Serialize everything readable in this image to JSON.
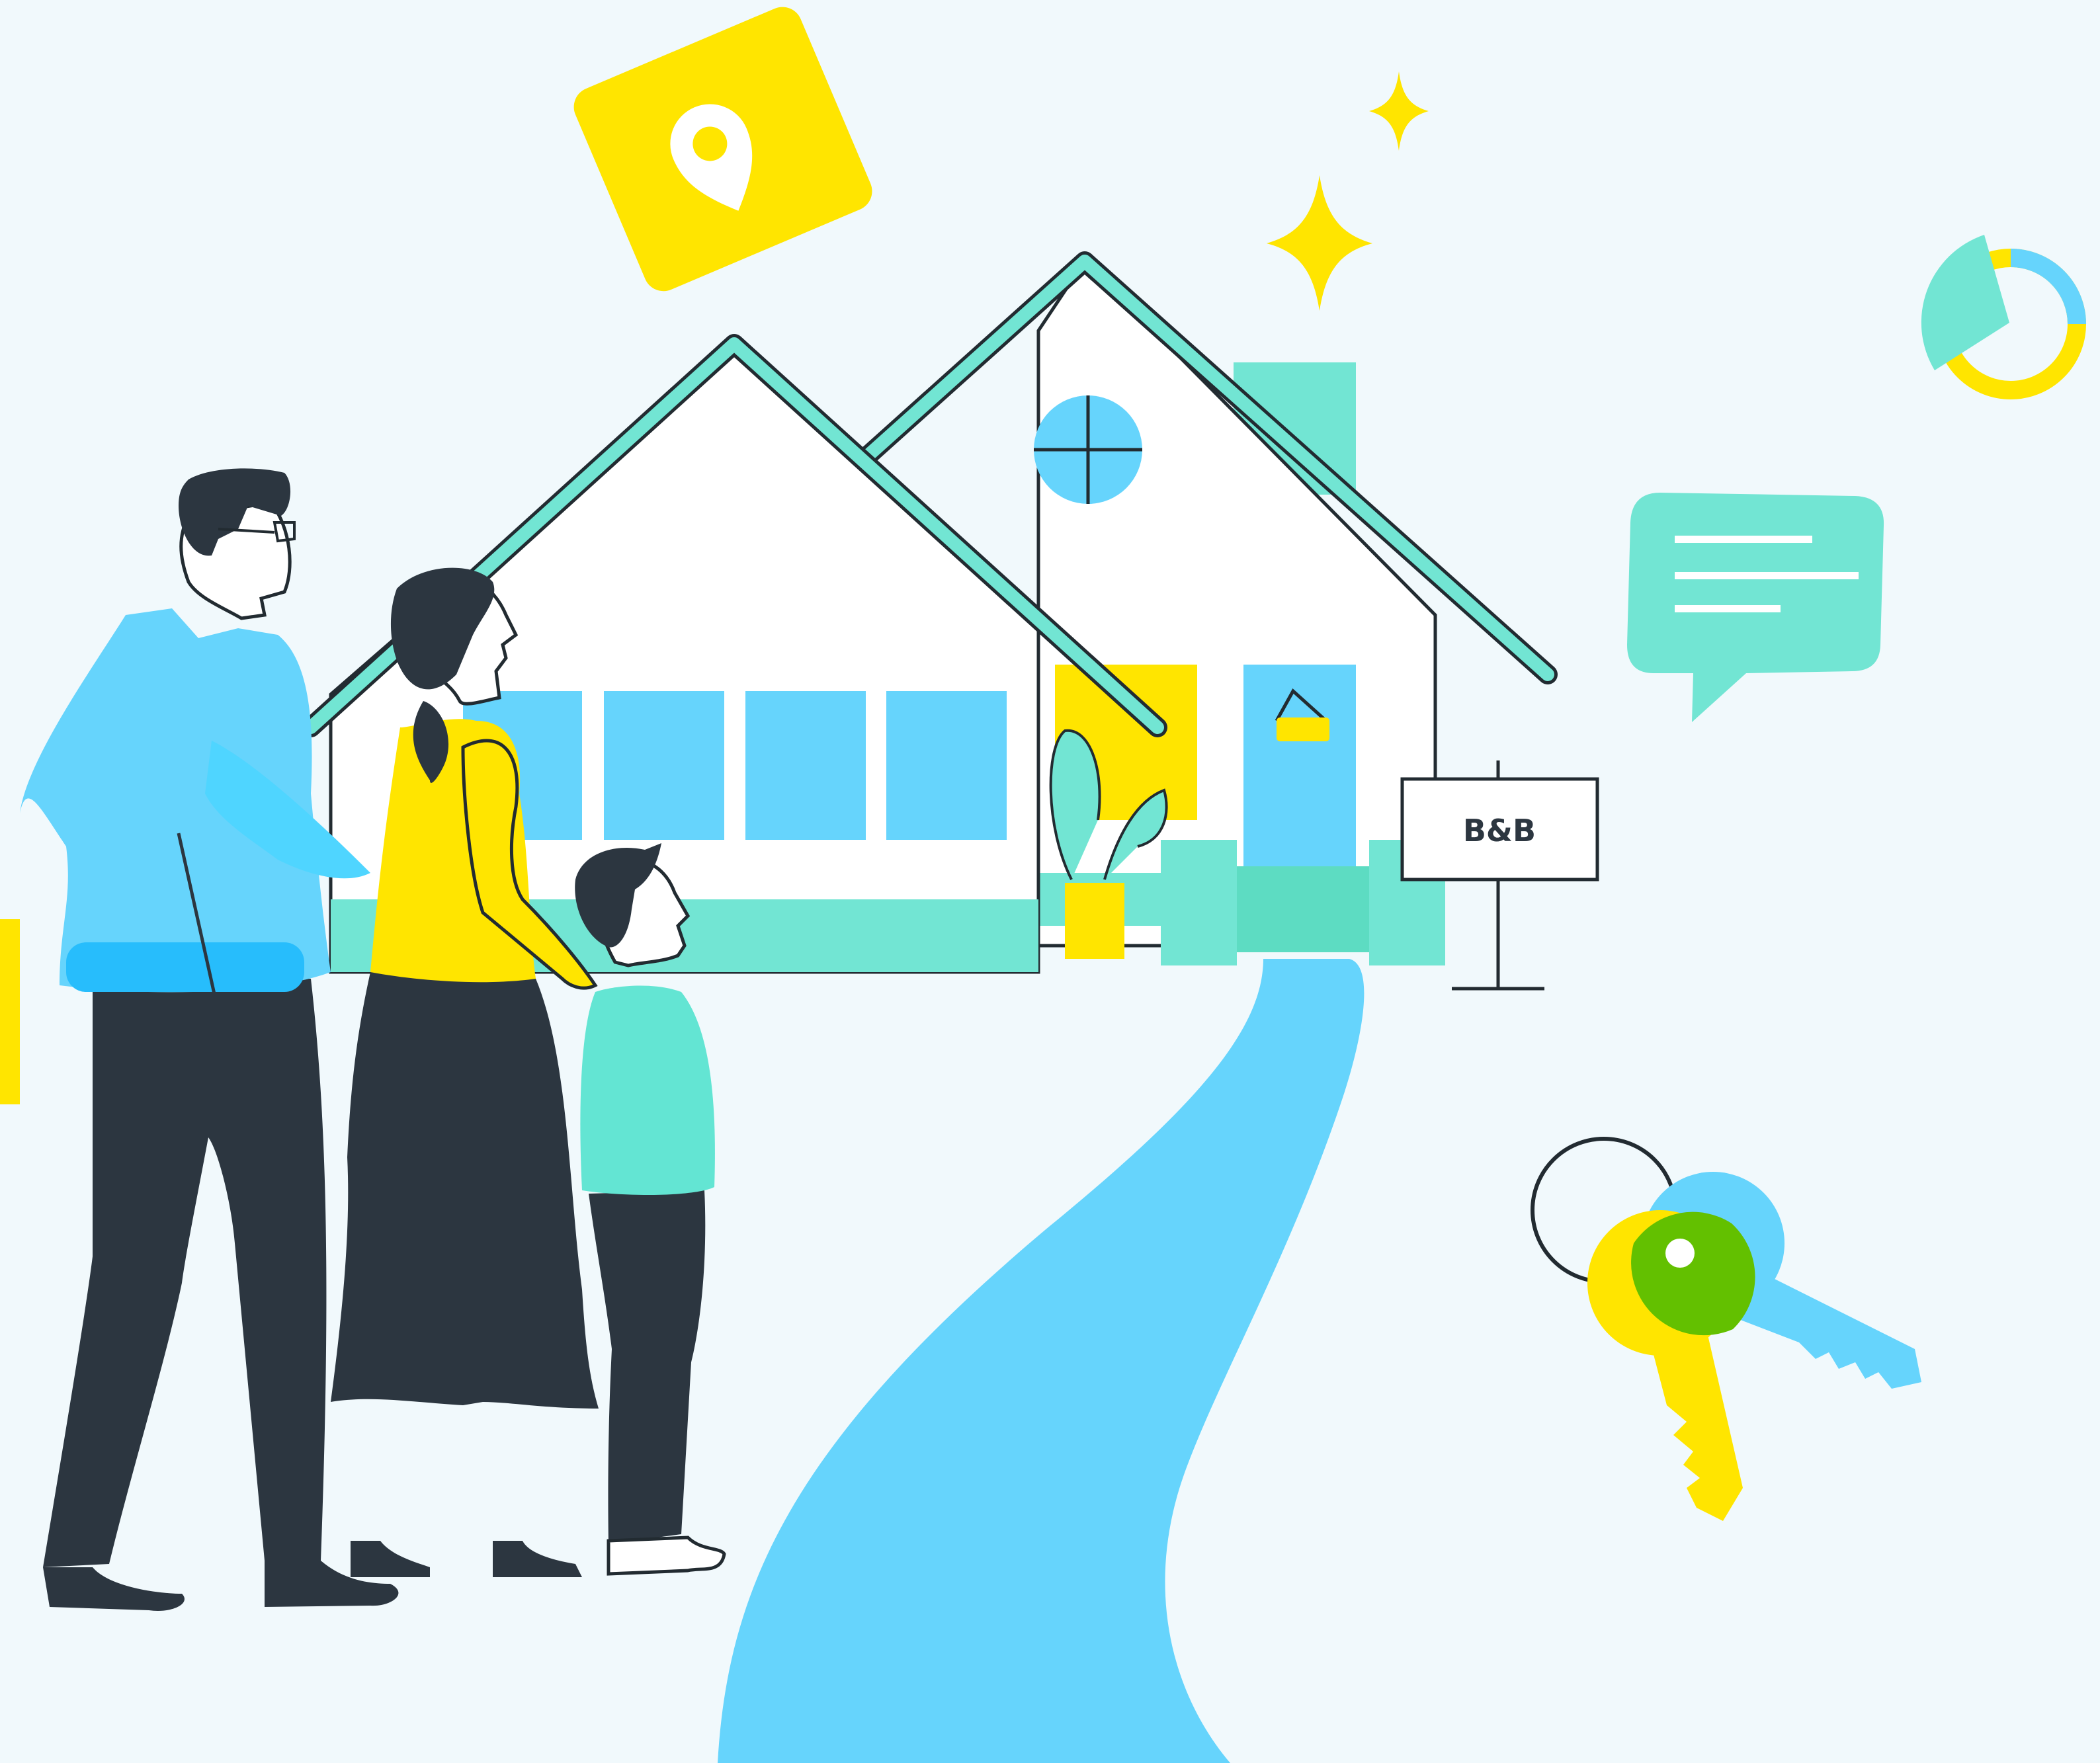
{
  "sign": {
    "label": "B&B"
  },
  "colors": {
    "background": "#f1f9fc",
    "sky_blue": "#66d4fc",
    "mint": "#72e5d3",
    "yellow": "#ffe500",
    "green": "#63c000",
    "dark": "#2c3640",
    "outline": "#222b31"
  },
  "icons": [
    "location-pin-icon",
    "sparkle-icon",
    "donut-chart-icon",
    "chat-bubble-icon",
    "keys-icon"
  ]
}
